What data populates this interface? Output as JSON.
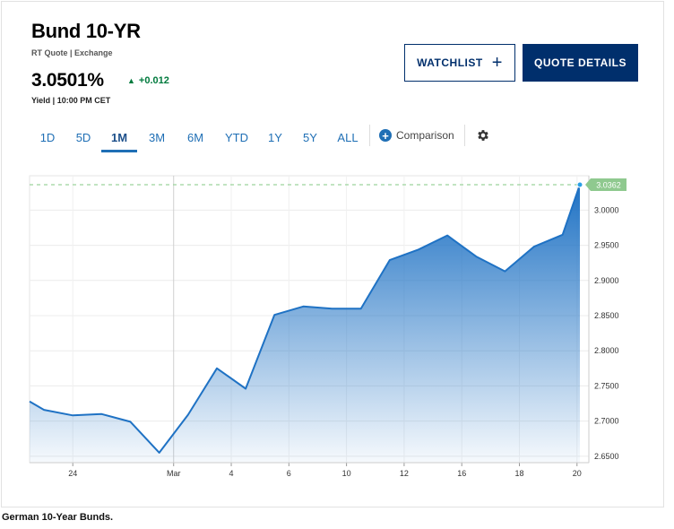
{
  "header": {
    "title": "Bund 10-YR",
    "quote_meta": "RT Quote | Exchange",
    "price": "3.0501%",
    "change": "+0.012",
    "yield_meta": "Yield | 10:00 PM CET"
  },
  "buttons": {
    "watchlist": "WATCHLIST",
    "quote_details": "QUOTE DETAILS"
  },
  "tabs": [
    {
      "label": "1D",
      "active": false
    },
    {
      "label": "5D",
      "active": false
    },
    {
      "label": "1M",
      "active": true
    },
    {
      "label": "3M",
      "active": false
    },
    {
      "label": "6M",
      "active": false
    },
    {
      "label": "YTD",
      "active": false
    },
    {
      "label": "1Y",
      "active": false
    },
    {
      "label": "5Y",
      "active": false
    },
    {
      "label": "ALL",
      "active": false
    }
  ],
  "comparison_label": "Comparison",
  "caption": "German 10-Year Bunds.",
  "colors": {
    "line": "#1f72c4",
    "area_top": "#1f72c4",
    "badge": "#8fc98f",
    "dash": "#9cd49c",
    "accent": "#002f6c",
    "positive": "#007a3d"
  },
  "chart_data": {
    "type": "area",
    "x_tick_labels": [
      "24",
      "Mar",
      "4",
      "6",
      "10",
      "12",
      "16",
      "18",
      "20"
    ],
    "x_tick_index": [
      1.5,
      5,
      7,
      9,
      11,
      13,
      15,
      17,
      19
    ],
    "x_index_range": [
      0,
      19.1
    ],
    "series": [
      {
        "values": [
          2.728,
          2.716,
          2.708,
          2.71,
          2.699,
          2.655,
          2.709,
          2.775,
          2.746,
          2.851,
          2.863,
          2.86,
          2.86,
          2.929,
          2.944,
          2.964,
          2.934,
          2.913,
          2.948,
          2.965,
          3.0362
        ]
      }
    ],
    "x": [
      0,
      0.5,
      1.5,
      2.5,
      3.5,
      4.5,
      5.5,
      6.5,
      7.5,
      8.5,
      9.5,
      10.5,
      11.5,
      12.5,
      13.5,
      14.5,
      15.5,
      16.5,
      17.5,
      18.5,
      19.1
    ],
    "y_ticks": [
      3.0,
      2.95,
      2.9,
      2.85,
      2.8,
      2.75,
      2.7,
      2.65
    ],
    "y_tick_labels": [
      "3.0000",
      "2.9500",
      "2.9000",
      "2.8500",
      "2.8000",
      "2.7500",
      "2.7000",
      "2.6500"
    ],
    "ylim": [
      2.6485,
      3.0362
    ],
    "last_value_label": "3.0362",
    "grid": true
  }
}
